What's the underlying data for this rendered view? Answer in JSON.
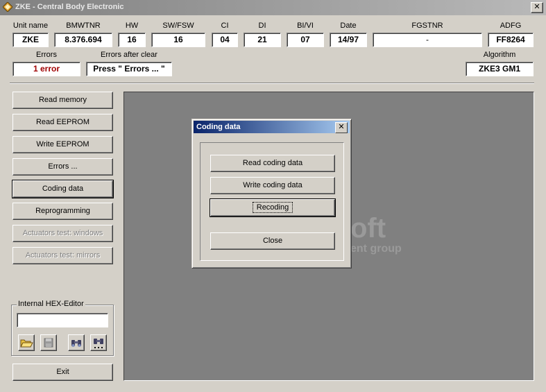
{
  "window": {
    "title": "ZKE - Central Body Electronic",
    "close_label": "✕"
  },
  "info": [
    {
      "key": "unit_name",
      "label": "Unit name",
      "value": "ZKE"
    },
    {
      "key": "bmwtnr",
      "label": "BMWTNR",
      "value": "8.376.694"
    },
    {
      "key": "hw",
      "label": "HW",
      "value": "16"
    },
    {
      "key": "sw_fsw",
      "label": "SW/FSW",
      "value": "16"
    },
    {
      "key": "ci",
      "label": "CI",
      "value": "04"
    },
    {
      "key": "di",
      "label": "DI",
      "value": "21"
    },
    {
      "key": "bi_vi",
      "label": "BI/VI",
      "value": "07"
    },
    {
      "key": "date",
      "label": "Date",
      "value": "14/97"
    },
    {
      "key": "fgstnr",
      "label": "FGSTNR",
      "value": "-"
    },
    {
      "key": "adfg",
      "label": "ADFG",
      "value": "FF8264"
    }
  ],
  "errors": {
    "label": "Errors",
    "value": "1 error"
  },
  "errors_after_clear": {
    "label": "Errors after clear",
    "value": "Press \" Errors ... \""
  },
  "algorithm": {
    "label": "Algorithm",
    "value": "ZKE3 GM1"
  },
  "side_buttons": [
    {
      "label": "Read memory",
      "enabled": true
    },
    {
      "label": "Read EEPROM",
      "enabled": true
    },
    {
      "label": "Write EEPROM",
      "enabled": true
    },
    {
      "label": "Errors ...",
      "enabled": true
    },
    {
      "label": "Coding data",
      "enabled": true
    },
    {
      "label": "Reprogramming",
      "enabled": true
    },
    {
      "label": "Actuators test: windows",
      "enabled": false
    },
    {
      "label": "Actuators test: mirrors",
      "enabled": false
    }
  ],
  "hex_editor": {
    "label": "Internal HEX-Editor",
    "value": "",
    "icons": [
      "open-folder-icon",
      "save-disk-icon",
      "find-binoculars-icon",
      "find-next-binoculars-icon"
    ]
  },
  "exit_label": "Exit",
  "watermark": {
    "line1": "oft",
    "line2": "ent group"
  },
  "dialog": {
    "title": "Coding data",
    "close_label": "✕",
    "buttons": [
      "Read coding data",
      "Write coding data",
      "Recoding",
      "Close"
    ]
  },
  "colors": {
    "title_active": "#0a246a",
    "title_inactive": "#808080",
    "error_red": "#a00000",
    "panel": "#808080",
    "face": "#d4d0c8"
  }
}
